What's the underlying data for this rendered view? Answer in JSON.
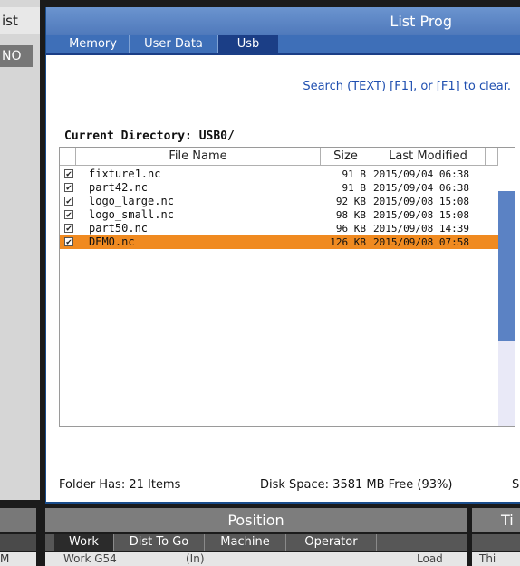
{
  "left_panel": {
    "title": "ist",
    "tab": "NO"
  },
  "window": {
    "title": "List Prog"
  },
  "tabs": [
    {
      "label": "Memory",
      "active": false
    },
    {
      "label": "User Data",
      "active": false
    },
    {
      "label": "Usb",
      "active": true
    }
  ],
  "search_hint": "Search (TEXT) [F1], or [F1] to clear.",
  "current_directory": "Current Directory: USB0/",
  "table": {
    "columns": [
      "File Name",
      "Size",
      "Last Modified"
    ],
    "rows": [
      {
        "name": "fixture1.nc",
        "size": "91 B",
        "modified": "2015/09/04 06:38",
        "checked": true,
        "selected": false
      },
      {
        "name": "part42.nc",
        "size": "91 B",
        "modified": "2015/09/04 06:38",
        "checked": true,
        "selected": false
      },
      {
        "name": "logo_large.nc",
        "size": "92 KB",
        "modified": "2015/09/08 15:08",
        "checked": true,
        "selected": false
      },
      {
        "name": "logo_small.nc",
        "size": "98 KB",
        "modified": "2015/09/08 15:08",
        "checked": true,
        "selected": false
      },
      {
        "name": "part50.nc",
        "size": "96 KB",
        "modified": "2015/09/08 14:39",
        "checked": true,
        "selected": false
      },
      {
        "name": "DEMO.nc",
        "size": "126 KB",
        "modified": "2015/09/08 07:58",
        "checked": true,
        "selected": true
      }
    ]
  },
  "status": {
    "folder_has": "Folder Has: 21 Items",
    "disk_space": "Disk Space: 3581 MB Free (93%)",
    "cut_text": "S"
  },
  "bottom_left": {
    "row_text": "M"
  },
  "position_panel": {
    "title": "Position",
    "tabs": [
      {
        "label": "Work",
        "active": true
      },
      {
        "label": "Dist To Go",
        "active": false
      },
      {
        "label": "Machine",
        "active": false
      },
      {
        "label": "Operator",
        "active": false
      }
    ],
    "row": {
      "work": "Work G54",
      "units": "(In)",
      "load": "Load"
    }
  },
  "right_panel": {
    "title": "Ti",
    "row_text": "Thi"
  },
  "colors": {
    "accent_blue": "#3e6fb8",
    "active_tab": "#1b3e86",
    "selected_row": "#f08a20",
    "hint_text": "#1f4fb0"
  }
}
